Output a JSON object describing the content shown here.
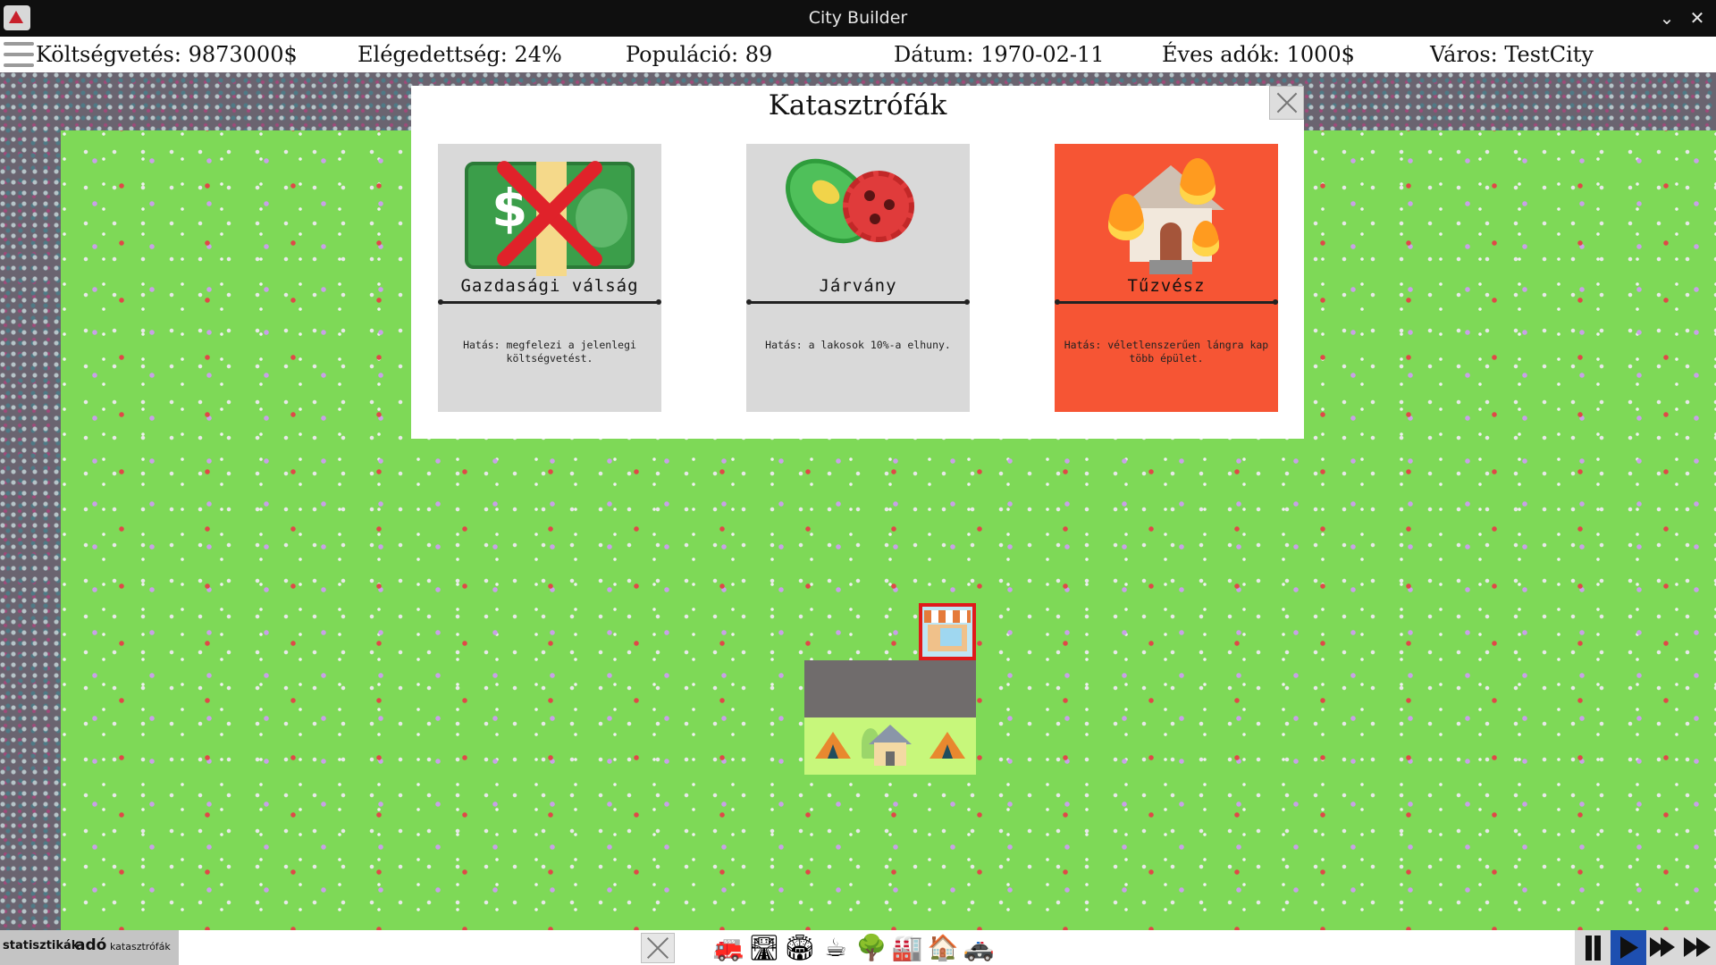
{
  "window": {
    "title": "City Builder"
  },
  "stats": {
    "budget": "Költségvetés: 9873000$",
    "satisfaction": "Elégedettség: 24%",
    "population": "Populáció: 89",
    "date": "Dátum: 1970-02-11",
    "annual_tax": "Éves adók: 1000$",
    "city": "Város: TestCity"
  },
  "dialog": {
    "title": "Katasztrófák",
    "cards": [
      {
        "title": "Gazdasági válság",
        "desc": "Hatás: megfelezi a jelenlegi költségvetést.",
        "icon": "economic-crisis-icon",
        "color": "#d9d9d9"
      },
      {
        "title": "Járvány",
        "desc": "Hatás: a lakosok 10%-a elhuny.",
        "icon": "epidemic-icon",
        "color": "#d9d9d9"
      },
      {
        "title": "Tűzvész",
        "desc": "Hatás: véletlenszerűen lángra kap több épület.",
        "icon": "fire-icon",
        "color": "#f65534"
      }
    ]
  },
  "bottom_tabs": {
    "stats": "statisztikák",
    "tax": "adó",
    "disasters": "katasztrófák"
  },
  "tools": [
    {
      "name": "fire-station-icon",
      "glyph": "🚒"
    },
    {
      "name": "road-icon",
      "glyph": "🛣"
    },
    {
      "name": "stadium-icon",
      "glyph": "🏟"
    },
    {
      "name": "cafe-icon",
      "glyph": "☕"
    },
    {
      "name": "tree-icon",
      "glyph": "🌳"
    },
    {
      "name": "factory-icon",
      "glyph": "🏭"
    },
    {
      "name": "house-icon",
      "glyph": "🏠"
    },
    {
      "name": "police-icon",
      "glyph": "🚓"
    }
  ],
  "colors": {
    "grass": "#7ed957",
    "fire_card": "#f65534",
    "play_active": "#1e4fb0"
  }
}
